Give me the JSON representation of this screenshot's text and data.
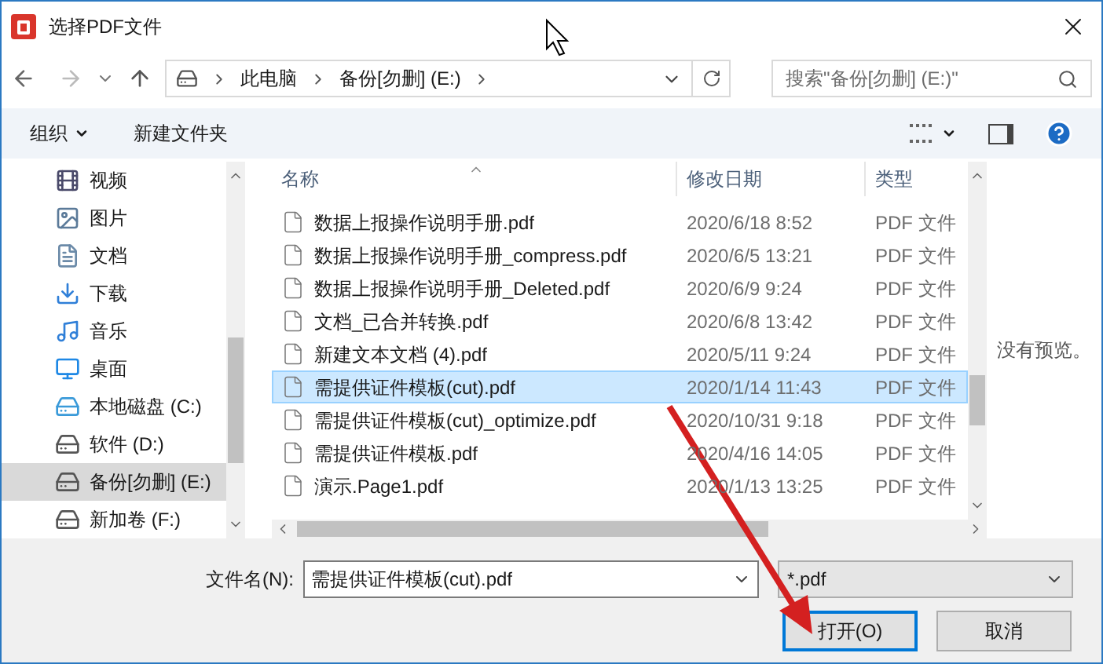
{
  "window": {
    "title": "选择PDF文件"
  },
  "address": {
    "path": [
      "此电脑",
      "备份[勿删] (E:)"
    ]
  },
  "search": {
    "placeholder": "搜索\"备份[勿删] (E:)\""
  },
  "toolbar": {
    "organize": "组织",
    "new_folder": "新建文件夹"
  },
  "nav_pane": {
    "items": [
      {
        "label": "视频",
        "kind": "video",
        "selected": false
      },
      {
        "label": "图片",
        "kind": "pictures",
        "selected": false
      },
      {
        "label": "文档",
        "kind": "documents",
        "selected": false
      },
      {
        "label": "下载",
        "kind": "downloads",
        "selected": false
      },
      {
        "label": "音乐",
        "kind": "music",
        "selected": false
      },
      {
        "label": "桌面",
        "kind": "desktop",
        "selected": false
      },
      {
        "label": "本地磁盘 (C:)",
        "kind": "system-drive",
        "selected": false
      },
      {
        "label": "软件 (D:)",
        "kind": "drive",
        "selected": false
      },
      {
        "label": "备份[勿删] (E:)",
        "kind": "drive",
        "selected": true
      },
      {
        "label": "新加卷 (F:)",
        "kind": "drive",
        "selected": false
      }
    ]
  },
  "file_list": {
    "columns": [
      "名称",
      "修改日期",
      "类型"
    ],
    "rows": [
      {
        "name": "数据上报操作说明手册.pdf",
        "date": "2020/6/18 8:52",
        "type": "PDF 文件",
        "selected": false
      },
      {
        "name": "数据上报操作说明手册_compress.pdf",
        "date": "2020/6/5 13:21",
        "type": "PDF 文件",
        "selected": false
      },
      {
        "name": "数据上报操作说明手册_Deleted.pdf",
        "date": "2020/6/9 9:24",
        "type": "PDF 文件",
        "selected": false
      },
      {
        "name": "文档_已合并转换.pdf",
        "date": "2020/6/8 13:42",
        "type": "PDF 文件",
        "selected": false
      },
      {
        "name": "新建文本文档 (4).pdf",
        "date": "2020/5/11 9:24",
        "type": "PDF 文件",
        "selected": false
      },
      {
        "name": "需提供证件模板(cut).pdf",
        "date": "2020/1/14 11:43",
        "type": "PDF 文件",
        "selected": true
      },
      {
        "name": "需提供证件模板(cut)_optimize.pdf",
        "date": "2020/10/31 9:18",
        "type": "PDF 文件",
        "selected": false
      },
      {
        "name": "需提供证件模板.pdf",
        "date": "2020/4/16 14:05",
        "type": "PDF 文件",
        "selected": false
      },
      {
        "name": "演示.Page1.pdf",
        "date": "2020/1/13 13:25",
        "type": "PDF 文件",
        "selected": false
      }
    ]
  },
  "preview": {
    "text": "没有预览。"
  },
  "filename": {
    "label": "文件名(N):",
    "value": "需提供证件模板(cut).pdf"
  },
  "filter": {
    "value": "*.pdf"
  },
  "buttons": [
    {
      "label": "打开(O)",
      "kind": "primary"
    },
    {
      "label": "取消",
      "kind": "normal"
    }
  ]
}
